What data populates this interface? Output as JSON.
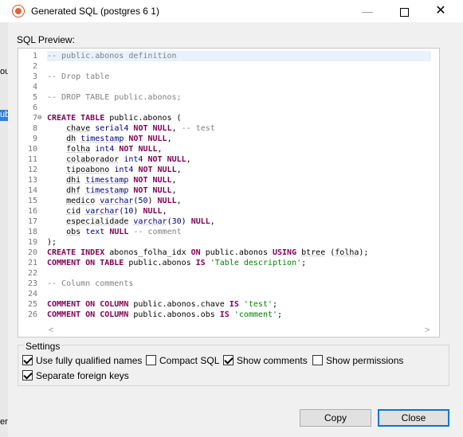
{
  "window": {
    "title": "Generated SQL (postgres 6 1)",
    "controls": {
      "minimize": "—",
      "close": "✕"
    }
  },
  "background_fragments": [
    "ou",
    "ub",
    "er"
  ],
  "preview": {
    "label": "SQL Preview:",
    "lines": [
      {
        "n": "1",
        "segs": [
          {
            "t": "-- public.abonos definition",
            "c": "cm"
          }
        ]
      },
      {
        "n": "2",
        "segs": []
      },
      {
        "n": "3",
        "segs": [
          {
            "t": "-- Drop table",
            "c": "cm"
          }
        ]
      },
      {
        "n": "4",
        "segs": []
      },
      {
        "n": "5",
        "segs": [
          {
            "t": "-- DROP TABLE public.abonos;",
            "c": "cm"
          }
        ]
      },
      {
        "n": "6",
        "segs": []
      },
      {
        "n": "7",
        "fold": "⊖",
        "segs": [
          {
            "t": "CREATE TABLE",
            "c": "kw"
          },
          {
            "t": " public.abonos (",
            "c": ""
          }
        ]
      },
      {
        "n": "8",
        "segs": [
          {
            "t": "    ",
            "c": ""
          },
          {
            "t": "chave",
            "c": "uq"
          },
          {
            "t": " ",
            "c": ""
          },
          {
            "t": "serial4",
            "c": "ty"
          },
          {
            "t": " ",
            "c": ""
          },
          {
            "t": "NOT NULL",
            "c": "kw"
          },
          {
            "t": ", ",
            "c": ""
          },
          {
            "t": "-- test",
            "c": "cm"
          }
        ]
      },
      {
        "n": "9",
        "segs": [
          {
            "t": "    ",
            "c": ""
          },
          {
            "t": "dh",
            "c": "uq"
          },
          {
            "t": " ",
            "c": ""
          },
          {
            "t": "timestamp",
            "c": "ty uq"
          },
          {
            "t": " ",
            "c": ""
          },
          {
            "t": "NOT NULL",
            "c": "kw"
          },
          {
            "t": ",",
            "c": ""
          }
        ]
      },
      {
        "n": "10",
        "segs": [
          {
            "t": "    ",
            "c": ""
          },
          {
            "t": "folha",
            "c": "uq"
          },
          {
            "t": " ",
            "c": ""
          },
          {
            "t": "int4",
            "c": "ty"
          },
          {
            "t": " ",
            "c": ""
          },
          {
            "t": "NOT NULL",
            "c": "kw"
          },
          {
            "t": ",",
            "c": ""
          }
        ]
      },
      {
        "n": "11",
        "segs": [
          {
            "t": "    ",
            "c": ""
          },
          {
            "t": "colaborador",
            "c": "uq"
          },
          {
            "t": " ",
            "c": ""
          },
          {
            "t": "int4",
            "c": "ty"
          },
          {
            "t": " ",
            "c": ""
          },
          {
            "t": "NOT NULL",
            "c": "kw"
          },
          {
            "t": ",",
            "c": ""
          }
        ]
      },
      {
        "n": "12",
        "segs": [
          {
            "t": "    ",
            "c": ""
          },
          {
            "t": "tipoabono",
            "c": "uq"
          },
          {
            "t": " ",
            "c": ""
          },
          {
            "t": "int4",
            "c": "ty"
          },
          {
            "t": " ",
            "c": ""
          },
          {
            "t": "NOT NULL",
            "c": "kw"
          },
          {
            "t": ",",
            "c": ""
          }
        ]
      },
      {
        "n": "13",
        "segs": [
          {
            "t": "    ",
            "c": ""
          },
          {
            "t": "dhi",
            "c": "uq"
          },
          {
            "t": " ",
            "c": ""
          },
          {
            "t": "timestamp",
            "c": "ty uq"
          },
          {
            "t": " ",
            "c": ""
          },
          {
            "t": "NOT NULL",
            "c": "kw"
          },
          {
            "t": ",",
            "c": ""
          }
        ]
      },
      {
        "n": "14",
        "segs": [
          {
            "t": "    ",
            "c": ""
          },
          {
            "t": "dhf",
            "c": "uq"
          },
          {
            "t": " ",
            "c": ""
          },
          {
            "t": "timestamp",
            "c": "ty uq"
          },
          {
            "t": " ",
            "c": ""
          },
          {
            "t": "NOT NULL",
            "c": "kw"
          },
          {
            "t": ",",
            "c": ""
          }
        ]
      },
      {
        "n": "15",
        "segs": [
          {
            "t": "    ",
            "c": ""
          },
          {
            "t": "medico",
            "c": "uq"
          },
          {
            "t": " ",
            "c": ""
          },
          {
            "t": "varchar",
            "c": "ty uq"
          },
          {
            "t": "(",
            "c": ""
          },
          {
            "t": "50",
            "c": "ty"
          },
          {
            "t": ") ",
            "c": ""
          },
          {
            "t": "NULL",
            "c": "kw"
          },
          {
            "t": ",",
            "c": ""
          }
        ]
      },
      {
        "n": "16",
        "segs": [
          {
            "t": "    ",
            "c": ""
          },
          {
            "t": "cid",
            "c": "uq"
          },
          {
            "t": " ",
            "c": ""
          },
          {
            "t": "varchar",
            "c": "ty uq"
          },
          {
            "t": "(",
            "c": ""
          },
          {
            "t": "10",
            "c": "ty"
          },
          {
            "t": ") ",
            "c": ""
          },
          {
            "t": "NULL",
            "c": "kw"
          },
          {
            "t": ",",
            "c": ""
          }
        ]
      },
      {
        "n": "17",
        "segs": [
          {
            "t": "    ",
            "c": ""
          },
          {
            "t": "especialidade",
            "c": "uq"
          },
          {
            "t": " ",
            "c": ""
          },
          {
            "t": "varchar",
            "c": "ty uq"
          },
          {
            "t": "(",
            "c": ""
          },
          {
            "t": "30",
            "c": "ty"
          },
          {
            "t": ") ",
            "c": ""
          },
          {
            "t": "NULL",
            "c": "kw"
          },
          {
            "t": ",",
            "c": ""
          }
        ]
      },
      {
        "n": "18",
        "segs": [
          {
            "t": "    ",
            "c": ""
          },
          {
            "t": "obs",
            "c": "uq"
          },
          {
            "t": " ",
            "c": ""
          },
          {
            "t": "text",
            "c": "ty"
          },
          {
            "t": " ",
            "c": ""
          },
          {
            "t": "NULL",
            "c": "kw"
          },
          {
            "t": " ",
            "c": ""
          },
          {
            "t": "-- comment",
            "c": "cm"
          }
        ]
      },
      {
        "n": "19",
        "segs": [
          {
            "t": ");",
            "c": ""
          }
        ]
      },
      {
        "n": "20",
        "segs": [
          {
            "t": "CREATE INDEX",
            "c": "kw"
          },
          {
            "t": " abonos_folha_idx ",
            "c": ""
          },
          {
            "t": "ON",
            "c": "kw"
          },
          {
            "t": " public.abonos ",
            "c": ""
          },
          {
            "t": "USING",
            "c": "kw"
          },
          {
            "t": " ",
            "c": ""
          },
          {
            "t": "btree",
            "c": "uq"
          },
          {
            "t": " (",
            "c": ""
          },
          {
            "t": "folha",
            "c": "uq"
          },
          {
            "t": ");",
            "c": ""
          }
        ]
      },
      {
        "n": "21",
        "segs": [
          {
            "t": "COMMENT ON TABLE",
            "c": "kw"
          },
          {
            "t": " public.abonos ",
            "c": ""
          },
          {
            "t": "IS",
            "c": "kw"
          },
          {
            "t": " ",
            "c": ""
          },
          {
            "t": "'Table description'",
            "c": "str"
          },
          {
            "t": ";",
            "c": ""
          }
        ]
      },
      {
        "n": "22",
        "segs": []
      },
      {
        "n": "23",
        "segs": [
          {
            "t": "-- Column comments",
            "c": "cm"
          }
        ]
      },
      {
        "n": "24",
        "segs": []
      },
      {
        "n": "25",
        "segs": [
          {
            "t": "COMMENT ON COLUMN",
            "c": "kw"
          },
          {
            "t": " public.abonos.chave ",
            "c": ""
          },
          {
            "t": "IS",
            "c": "kw"
          },
          {
            "t": " ",
            "c": ""
          },
          {
            "t": "'test'",
            "c": "str"
          },
          {
            "t": ";",
            "c": ""
          }
        ]
      },
      {
        "n": "26",
        "segs": [
          {
            "t": "COMMENT ON COLUMN",
            "c": "kw"
          },
          {
            "t": " public.abonos.obs ",
            "c": ""
          },
          {
            "t": "IS",
            "c": "kw"
          },
          {
            "t": " ",
            "c": ""
          },
          {
            "t": "'comment'",
            "c": "str"
          },
          {
            "t": ";",
            "c": ""
          }
        ]
      }
    ],
    "scroll_left": "<",
    "scroll_right": ">"
  },
  "settings": {
    "title": "Settings",
    "options": [
      {
        "label": "Use fully qualified names",
        "checked": true
      },
      {
        "label": "Compact SQL",
        "checked": false
      },
      {
        "label": "Show comments",
        "checked": true
      },
      {
        "label": "Show permissions",
        "checked": false
      },
      {
        "label": "Separate foreign keys",
        "checked": true
      }
    ]
  },
  "buttons": {
    "copy": "Copy",
    "close": "Close"
  },
  "colors": {
    "keyword": "#7f0055",
    "comment": "#808080",
    "string": "#008000",
    "type": "#00007f",
    "primary_border": "#0078d7",
    "current_line": "#e8f2fe"
  }
}
